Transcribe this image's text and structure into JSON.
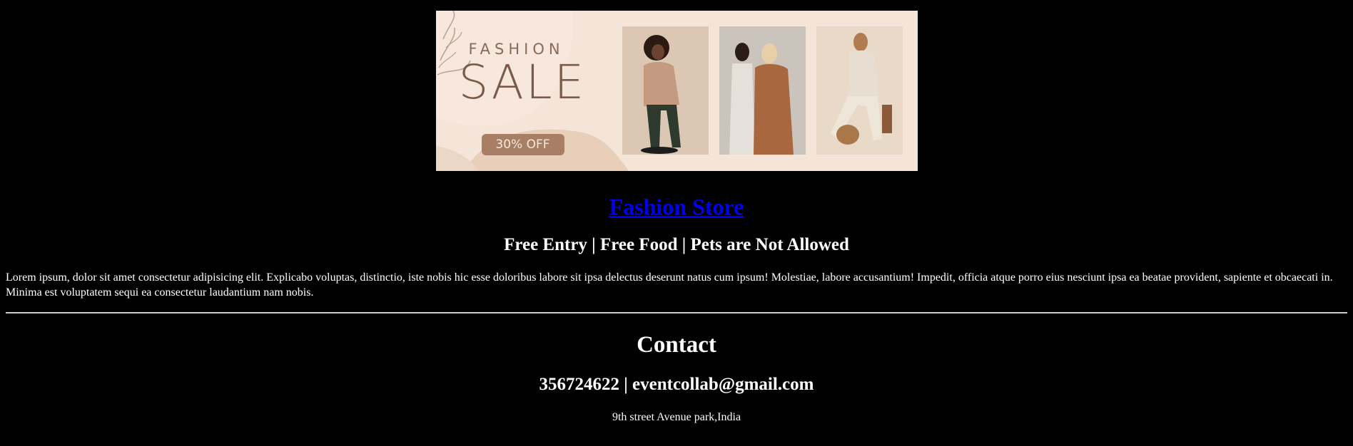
{
  "banner": {
    "top_text": "FASHION",
    "main_text": "SALE",
    "discount": "30% OFF",
    "colors": {
      "background": "#f5e4d8",
      "text": "#7a5a48",
      "pill": "#a87e65"
    }
  },
  "store": {
    "title": "Fashion Store"
  },
  "tagline": "Free Entry | Free Food | Pets are Not Allowed",
  "description": "Lorem ipsum, dolor sit amet consectetur adipisicing elit. Explicabo voluptas, distinctio, iste nobis hic esse doloribus labore sit ipsa delectus deserunt natus cum ipsum! Molestiae, labore accusantium! Impedit, officia atque porro eius nesciunt ipsa ea beatae provident, sapiente et obcaecati in. Minima est voluptatem sequi ea consectetur laudantium nam nobis.",
  "contact": {
    "title": "Contact",
    "line": "356724622 | eventcollab@gmail.com",
    "address": "9th street Avenue park,India"
  },
  "colors": {
    "page_background": "#000000",
    "text": "#ffffff",
    "link": "#0000ee"
  }
}
